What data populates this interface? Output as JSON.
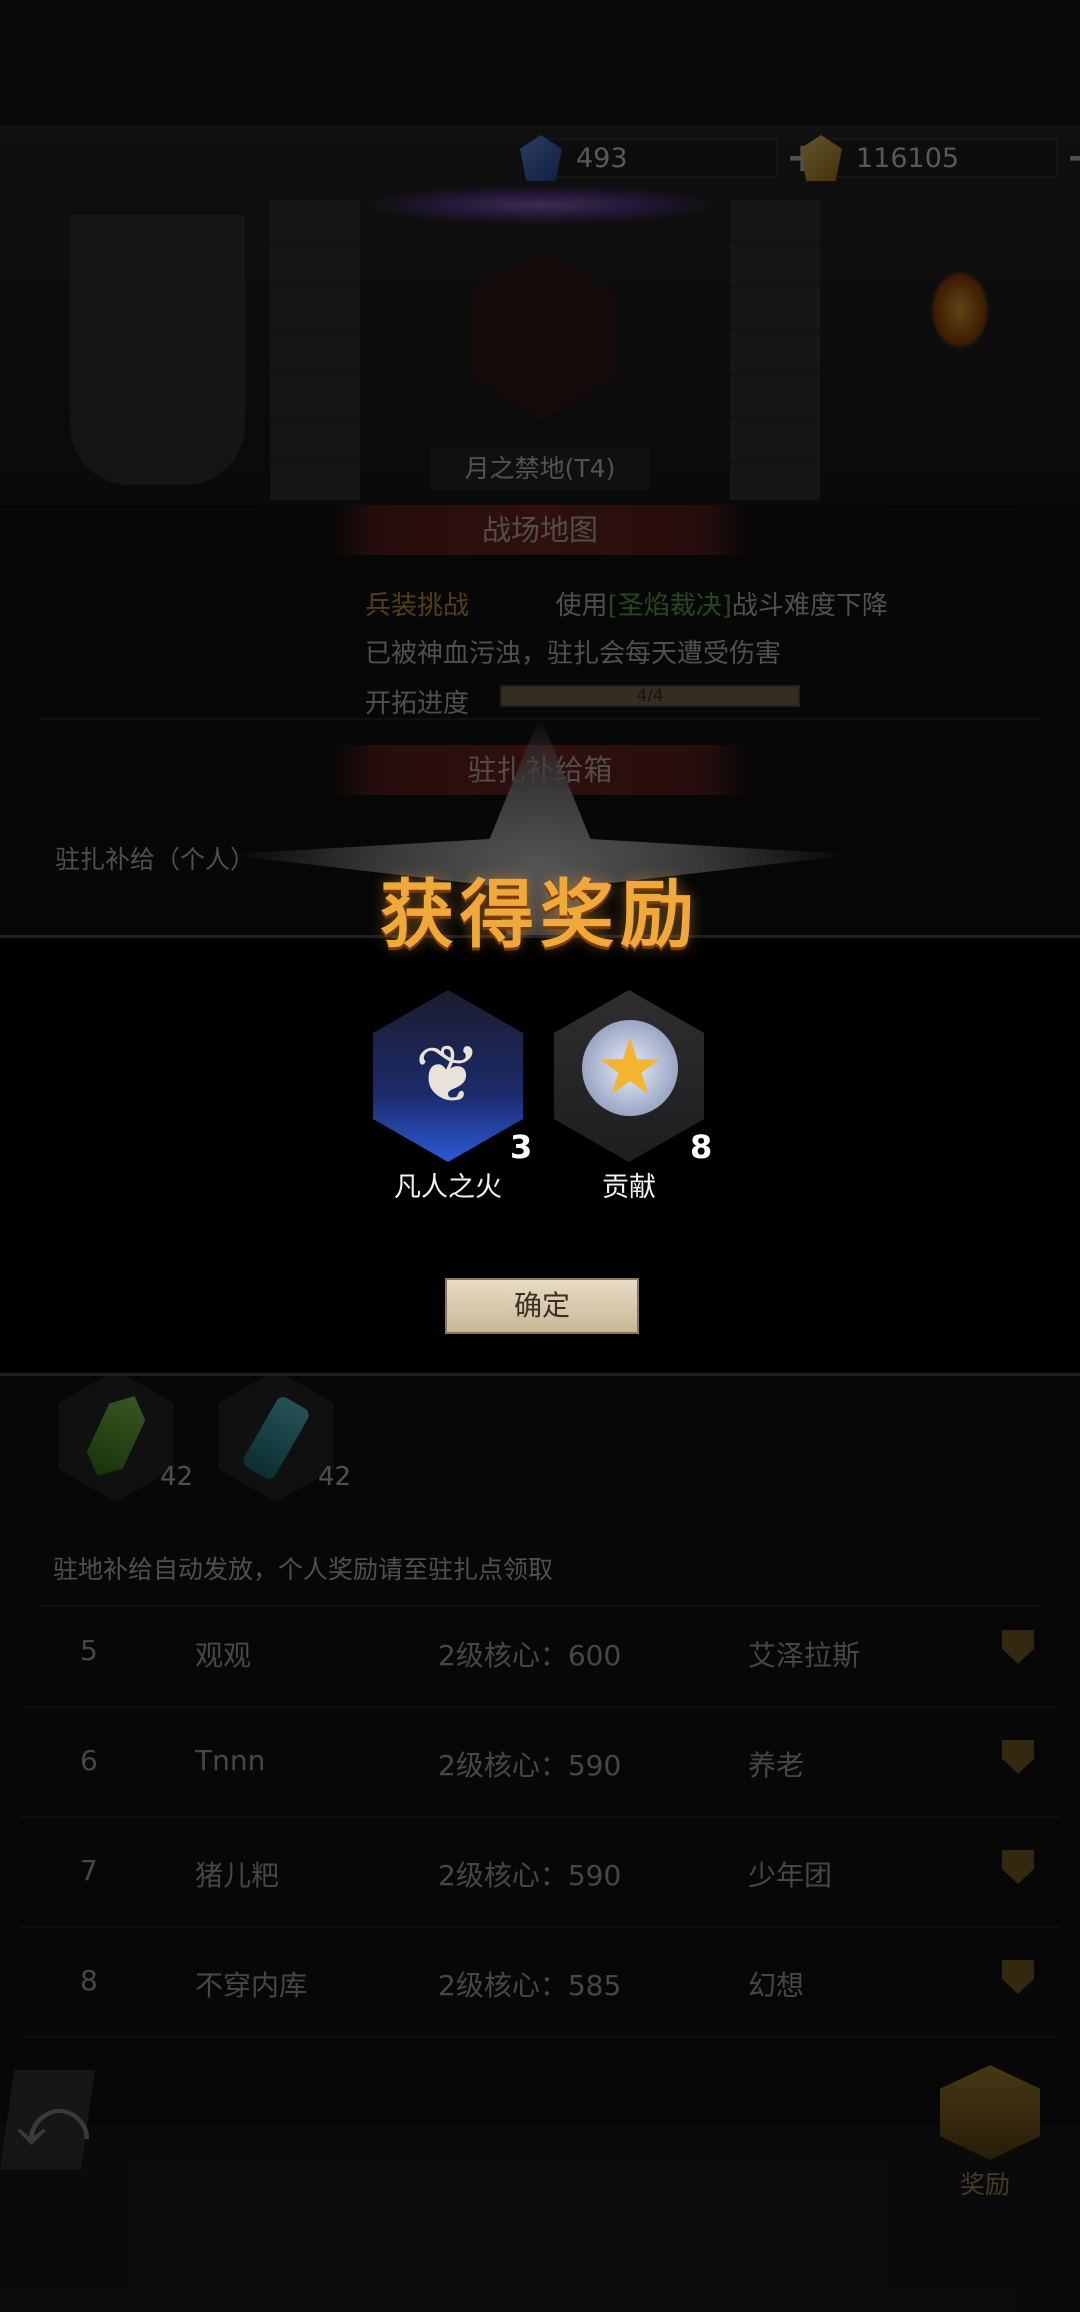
{
  "resources": [
    {
      "icon": "blue-crystal-icon",
      "value": "493"
    },
    {
      "icon": "gold-coin-icon",
      "value": "116105"
    }
  ],
  "map_name": "月之禁地(T4)",
  "sections": {
    "battlefield_map": "战场地图",
    "supply_box": "驻扎补给箱"
  },
  "battlefield": {
    "challenge_label": "兵装挑战",
    "use_prefix": "使用",
    "use_item": "[圣焰裁决]",
    "use_suffix": "战斗难度下降",
    "curse_text": "已被神血污浊，驻扎会每天遭受伤害",
    "progress_label": "开拓进度",
    "progress_value": "4/4",
    "progress_fraction": 1.0
  },
  "supply": {
    "personal_label": "驻扎补给（个人）",
    "items": [
      {
        "icon": "green-crystal-icon",
        "count": "42"
      },
      {
        "icon": "potion-vial-icon",
        "count": "42"
      }
    ],
    "note": "驻地补给自动发放，个人奖励请至驻扎点领取"
  },
  "ranking": [
    {
      "rank": "5",
      "name": "观观",
      "score": "2级核心：600",
      "guild": "艾泽拉斯"
    },
    {
      "rank": "6",
      "name": "Tnnn",
      "score": "2级核心：590",
      "guild": "养老"
    },
    {
      "rank": "7",
      "name": "猪儿粑",
      "score": "2级核心：590",
      "guild": "少年团"
    },
    {
      "rank": "8",
      "name": "不穿内库",
      "score": "2级核心：585",
      "guild": "幻想"
    }
  ],
  "bottom": {
    "rewards_label": "奖励"
  },
  "modal": {
    "title": "获得奖励",
    "rewards": [
      {
        "name": "凡人之火",
        "count": "3",
        "icon": "flame-icon"
      },
      {
        "name": "贡献",
        "count": "8",
        "icon": "star-medal-icon"
      }
    ],
    "confirm_label": "确定"
  }
}
